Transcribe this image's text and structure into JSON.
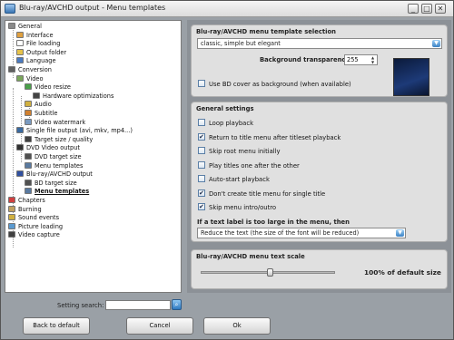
{
  "window": {
    "title": "Blu-ray/AVCHD output - Menu templates",
    "controls": [
      "_",
      "□",
      "✕"
    ]
  },
  "tree": [
    {
      "label": "General",
      "icon": "wrench-icon",
      "color": "#8a8a8a"
    },
    {
      "label": "Interface",
      "icon": "paint-icon",
      "color": "#e0a040"
    },
    {
      "label": "File loading",
      "icon": "file-icon",
      "color": "#ffffff"
    },
    {
      "label": "Output folder",
      "icon": "folder-icon",
      "color": "#e6c24a"
    },
    {
      "label": "Language",
      "icon": "globe-icon",
      "color": "#4a7ac0"
    },
    {
      "label": "Conversion",
      "icon": "gear-icon",
      "color": "#606060"
    },
    {
      "label": "Video",
      "icon": "film-icon",
      "color": "#7aa65a"
    },
    {
      "label": "Video resize",
      "icon": "resize-icon",
      "color": "#4aa04a"
    },
    {
      "label": "Hardware optimizations",
      "icon": "chip-icon",
      "color": "#444444"
    },
    {
      "label": "Audio",
      "icon": "speaker-icon",
      "color": "#d0b040"
    },
    {
      "label": "Subtitle",
      "icon": "subtitle-icon",
      "color": "#d08030"
    },
    {
      "label": "Video watermark",
      "icon": "watermark-icon",
      "color": "#7a9ac0"
    },
    {
      "label": "Single file output (avi, mkv, mp4...)",
      "icon": "file-video-icon",
      "color": "#3a6aa0"
    },
    {
      "label": "Target size / quality",
      "icon": "target-icon",
      "color": "#404040"
    },
    {
      "label": "DVD Video output",
      "icon": "dvd-icon",
      "color": "#303030"
    },
    {
      "label": "DVD target size",
      "icon": "disc-icon",
      "color": "#505050"
    },
    {
      "label": "Menu templates",
      "icon": "menu-icon",
      "color": "#5a7aa0"
    },
    {
      "label": "Blu-ray/AVCHD output",
      "icon": "bluray-icon",
      "color": "#3050a0"
    },
    {
      "label": "BD target size",
      "icon": "disc-icon",
      "color": "#505050"
    },
    {
      "label": "Menu templates",
      "icon": "menu-icon",
      "color": "#5a7aa0"
    },
    {
      "label": "Chapters",
      "icon": "flag-icon",
      "color": "#d04040"
    },
    {
      "label": "Burning",
      "icon": "burn-icon",
      "color": "#c0a060"
    },
    {
      "label": "Sound events",
      "icon": "speaker-icon",
      "color": "#d0b040"
    },
    {
      "label": "Picture loading",
      "icon": "picture-icon",
      "color": "#5a9ad0"
    },
    {
      "label": "Video capture",
      "icon": "capture-icon",
      "color": "#404040"
    }
  ],
  "template_group": {
    "title": "Blu-ray/AVCHD menu template selection",
    "template_value": "classic, simple but elegant",
    "transparency_label": "Background transparency",
    "transparency_value": "255",
    "bd_cover_label": "Use BD cover as background (when available)",
    "bd_cover_checked": false
  },
  "general_group": {
    "title": "General settings",
    "options": [
      {
        "label": "Loop playback",
        "checked": false
      },
      {
        "label": "Return to title menu after titleset playback",
        "checked": true
      },
      {
        "label": "Skip root menu initially",
        "checked": false
      },
      {
        "label": "Play titles one after the other",
        "checked": false
      },
      {
        "label": "Auto-start playback",
        "checked": false
      },
      {
        "label": "Don't create title menu for single title",
        "checked": true
      },
      {
        "label": "Skip menu intro/outro",
        "checked": true
      }
    ],
    "text_label_question": "If a text label is too large in the menu, then",
    "text_label_value": "Reduce the text (the size of the font will be reduced)"
  },
  "scale_group": {
    "title": "Blu-ray/AVCHD menu text scale",
    "value_label": "100% of default size",
    "slider_fraction": 0.52
  },
  "search": {
    "label": "Setting search:",
    "value": ""
  },
  "buttons": {
    "back": "Back to default",
    "cancel": "Cancel",
    "ok": "Ok"
  },
  "colors": {
    "accent": "#3b82c4"
  }
}
